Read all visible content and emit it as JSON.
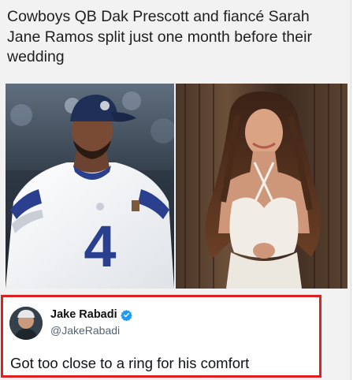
{
  "post": {
    "headline": "Cowboys QB Dak Prescott and fiancé Sarah Jane Ramos split just one month before their wedding",
    "photos": {
      "left": {
        "jersey_number": "4"
      },
      "right": {}
    }
  },
  "tweet": {
    "display_name": "Jake Rabadi",
    "handle": "@JakeRabadi",
    "text": "Got too close to a ring for his comfort",
    "verified_icon": "verified-badge-icon",
    "highlight_color": "#e02020",
    "verified_color": "#1d9bf0"
  }
}
